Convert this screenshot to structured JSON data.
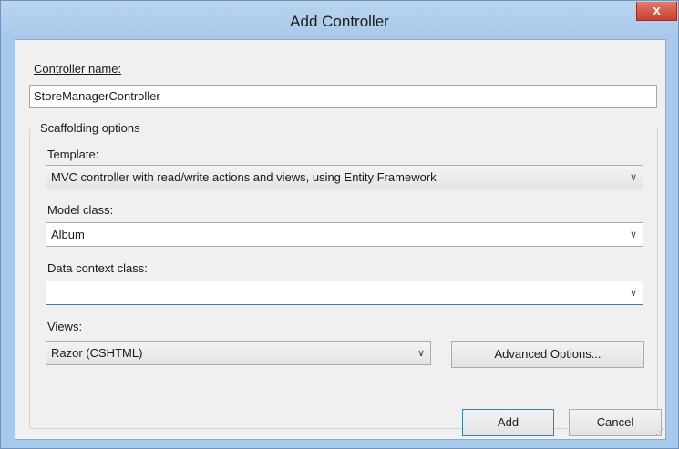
{
  "window": {
    "title": "Add Controller",
    "close_glyph": "x"
  },
  "form": {
    "controller_name_label": "Controller name:",
    "controller_name_value": "StoreManagerController",
    "scaffolding_group_label": "Scaffolding options",
    "template_label": "Template:",
    "template_value": "MVC controller with read/write actions and views, using Entity Framework",
    "model_class_label": "Model class:",
    "model_class_value": "Album",
    "data_context_label": "Data context class:",
    "data_context_value": "",
    "views_label": "Views:",
    "views_value": "Razor (CSHTML)"
  },
  "buttons": {
    "advanced_options": "Advanced Options...",
    "add": "Add",
    "cancel": "Cancel"
  },
  "icons": {
    "dropdown": "chevron-down-icon",
    "close": "close-icon"
  },
  "colors": {
    "titlebar": "#a9c8ea",
    "client": "#f0f0f0",
    "focus_border": "#3c7fb1",
    "close_button": "#c7412f"
  }
}
